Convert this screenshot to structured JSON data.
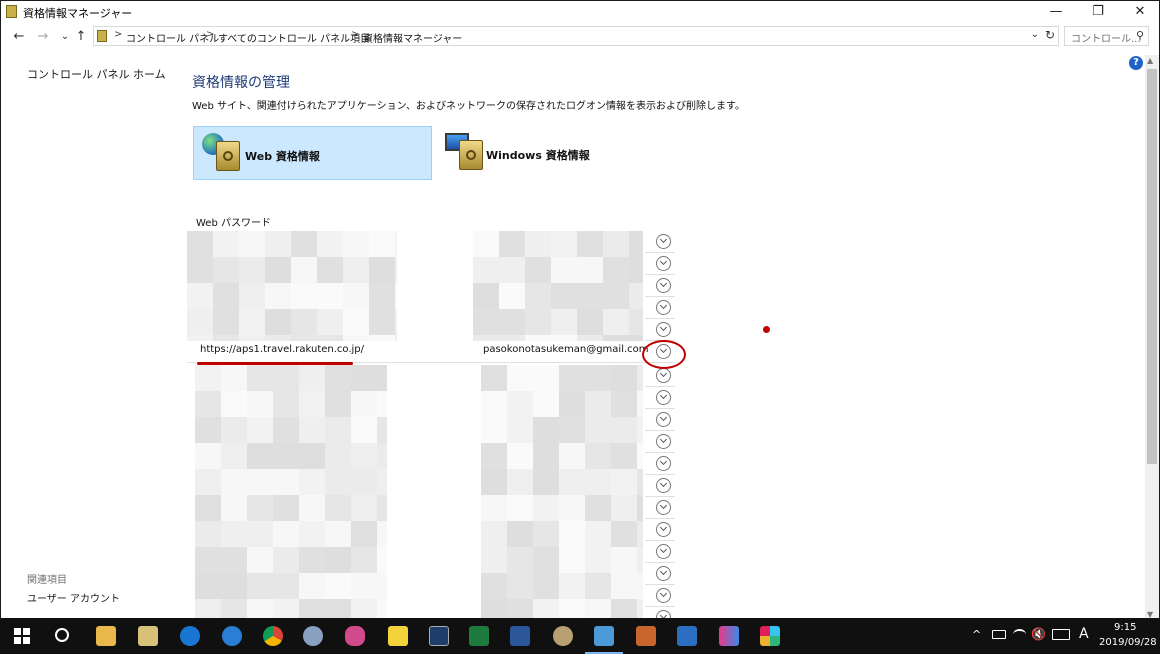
{
  "window": {
    "title": "資格情報マネージャー",
    "minimize_glyph": "—",
    "restore_glyph": "❐",
    "close_glyph": "✕"
  },
  "nav": {
    "back_glyph": "←",
    "forward_glyph": "→",
    "recent_glyph": "⌄",
    "up_glyph": "↑",
    "breadcrumb": [
      "コントロール パネル",
      "すべてのコントロール パネル項目",
      "資格情報マネージャー"
    ],
    "separator": ">",
    "dropdown_glyph": "⌄",
    "refresh_glyph": "↻",
    "search_placeholder": "コントロール...",
    "search_glyph": "⚲"
  },
  "sidebar": {
    "home_link": "コントロール パネル ホーム",
    "related_heading": "関連項目",
    "user_accounts_link": "ユーザー アカウント"
  },
  "main": {
    "help_glyph": "?",
    "title": "資格情報の管理",
    "description": "Web サイト、関連付けられたアプリケーション、およびネットワークの保存されたログオン情報を表示および削除します。",
    "tiles": [
      {
        "label": "Web 資格情報",
        "selected": true,
        "icon": "web-vault-icon"
      },
      {
        "label": "Windows 資格情報",
        "selected": false,
        "icon": "windows-vault-icon"
      }
    ],
    "section_title": "Web パスワード",
    "highlighted_entry": {
      "url": "https://aps1.travel.rakuten.co.jp/",
      "user": "pasokonotasukeman@gmail.com"
    },
    "rows_above": 5,
    "rows_below": 12
  },
  "taskbar": {
    "clock_time": "9:15",
    "clock_date": "2019/09/28",
    "ime_glyph": "A",
    "chevron_glyph": "^",
    "accent_color": "#7fb3ee"
  },
  "colors": {
    "annotation_red": "#c00000",
    "selected_tile_bg": "#cce8ff",
    "title_blue": "#1e3a78"
  }
}
